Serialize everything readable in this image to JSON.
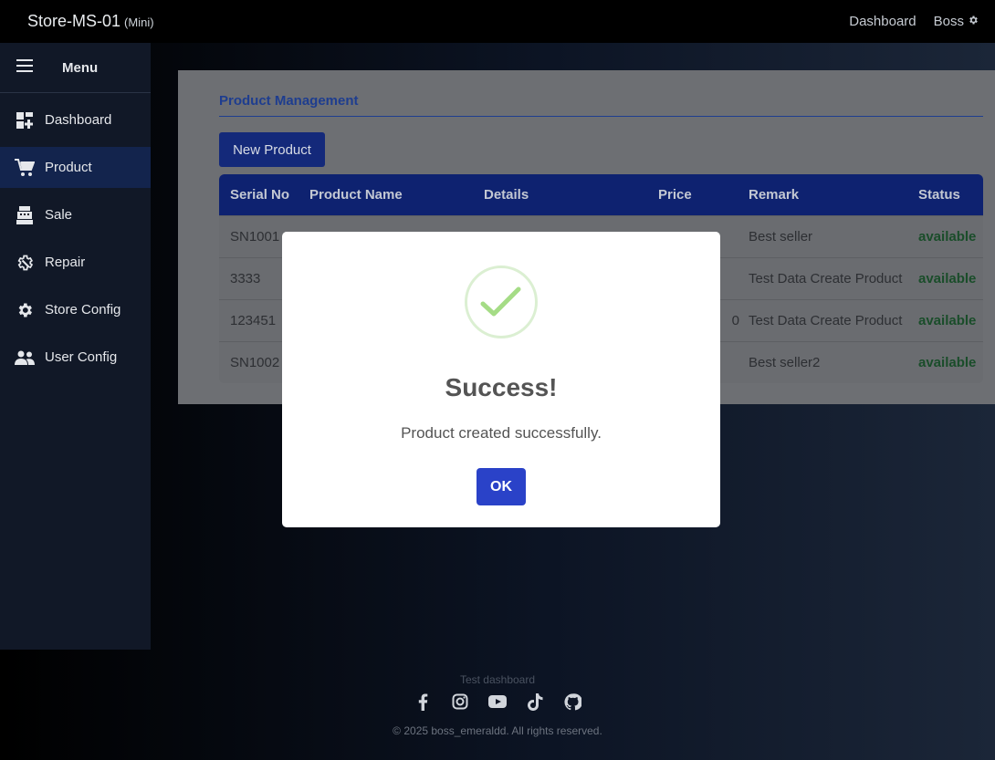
{
  "topbar": {
    "brand": "Store-MS-01",
    "brand_suffix": "(Mini)",
    "dashboard_link": "Dashboard",
    "user_link": "Boss"
  },
  "sidebar": {
    "title": "Menu",
    "items": [
      {
        "label": "Dashboard",
        "icon": "dashboard-icon"
      },
      {
        "label": "Product",
        "icon": "cart-icon",
        "active": true
      },
      {
        "label": "Sale",
        "icon": "cash-register-icon"
      },
      {
        "label": "Repair",
        "icon": "repair-gear-icon"
      },
      {
        "label": "Store Config",
        "icon": "gear-icon"
      },
      {
        "label": "User Config",
        "icon": "users-icon"
      }
    ]
  },
  "main": {
    "section_title": "Product Management",
    "new_button": "New Product",
    "table": {
      "columns": [
        "Serial No",
        "Product Name",
        "Details",
        "Price",
        "Remark",
        "Status"
      ],
      "rows": [
        {
          "serial": "SN1001",
          "name": "",
          "details": "",
          "price": "",
          "remark": "Best seller",
          "status": "available"
        },
        {
          "serial": "3333",
          "name": "",
          "details": "",
          "price": "",
          "remark": "Test Data Create Product",
          "status": "available"
        },
        {
          "serial": "123451",
          "name": "",
          "details": "",
          "price": "0",
          "remark": "Test Data Create Product",
          "status": "available"
        },
        {
          "serial": "SN1002",
          "name": "",
          "details": "",
          "price": "",
          "remark": "Best seller2",
          "status": "available"
        }
      ]
    }
  },
  "modal": {
    "icon": "success-check-icon",
    "title": "Success!",
    "message": "Product created successfully.",
    "ok_label": "OK"
  },
  "footer": {
    "caption": "Test dashboard",
    "socials": [
      "facebook-icon",
      "instagram-icon",
      "youtube-icon",
      "tiktok-icon",
      "github-icon"
    ],
    "copyright": "© 2025 boss_emeraldd. All rights reserved."
  },
  "colors": {
    "accent": "#2a42c8",
    "status_available": "#1f8a3a",
    "check_green": "#a5dc86"
  }
}
